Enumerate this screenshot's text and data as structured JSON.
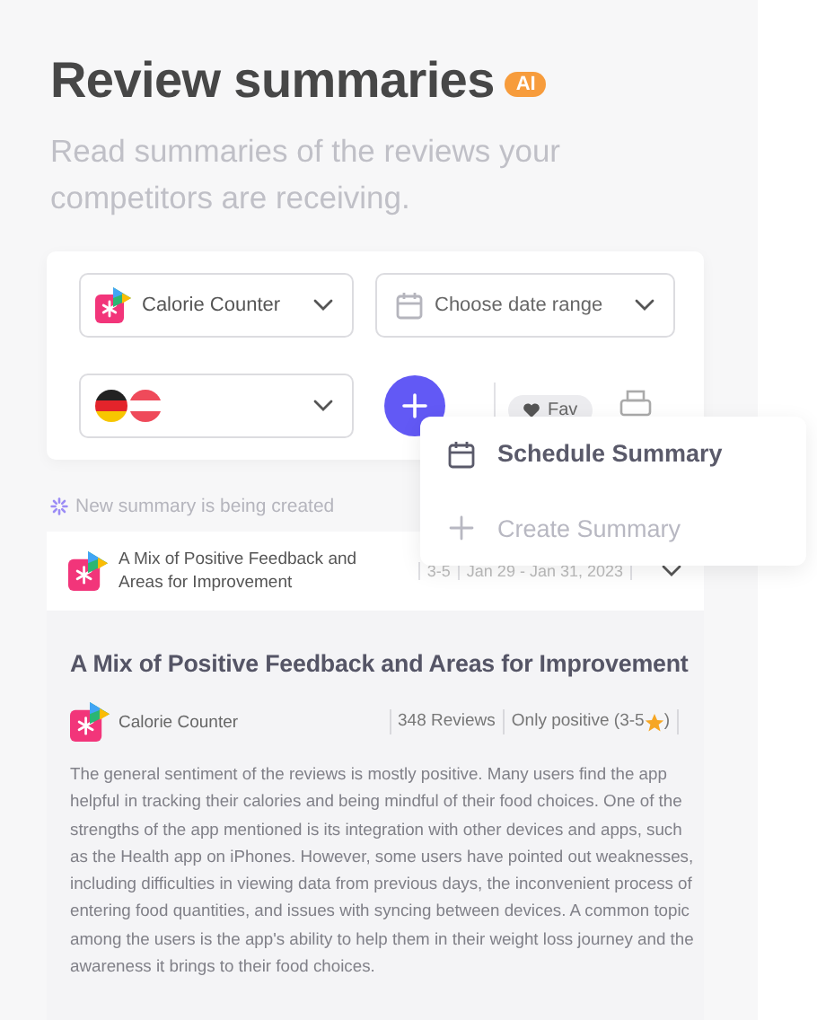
{
  "header": {
    "title": "Review summaries",
    "badge": "AI",
    "subtitle": "Read summaries of the reviews your competitors are receiving."
  },
  "filters": {
    "app": {
      "label": "Calorie Counter"
    },
    "date": {
      "placeholder": "Choose date range"
    },
    "countries": [
      {
        "kind": "germany"
      },
      {
        "kind": "austria"
      }
    ],
    "fav": {
      "label": "Fav"
    }
  },
  "menu": [
    {
      "label": "Schedule Summary",
      "kind": "calendar",
      "disabled": false
    },
    {
      "label": "Create Summary",
      "kind": "plus",
      "disabled": true
    }
  ],
  "status": "New summary is being created",
  "summary": {
    "header_title": "A Mix of Positive Feedback and Areas for Improvement",
    "rating_range": "3-5",
    "date_range": "Jan 29 - Jan 31, 2023",
    "expanded": true,
    "title": "A Mix of Positive Feedback and Areas for Improvement",
    "app": "Calorie Counter",
    "review_count": "348 Reviews",
    "filter_label": "Only positive (3-5",
    "filter_close": ")",
    "text": "The general sentiment of the reviews is mostly positive. Many users find the app helpful in tracking their calories and being mindful of their food choices. One of the strengths of the app mentioned is its integration with other devices and apps, such as the Health app on iPhones. However, some users have pointed out weaknesses, including difficulties in viewing data from previous days, the inconvenient process of entering food quantities, and issues with syncing between devices. A common topic among the users is the app's ability to help them in their weight loss journey and the awareness it brings to their food choices."
  }
}
